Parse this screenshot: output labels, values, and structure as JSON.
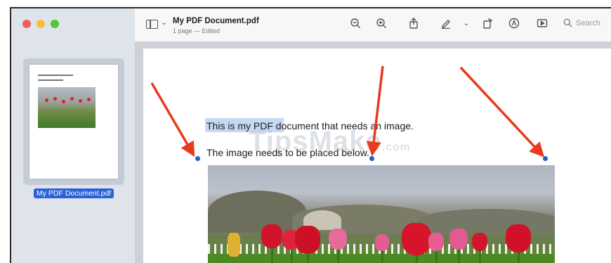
{
  "window": {
    "title": "My PDF Document.pdf",
    "subtitle": "1 page — Edited"
  },
  "sidebar": {
    "thumbnail_label": "My PDF Document.pdf"
  },
  "toolbar": {
    "search_placeholder": "Search",
    "icons": [
      "sidebar-toggle-icon",
      "zoom-out-icon",
      "zoom-in-icon",
      "share-icon",
      "markup-pen-icon",
      "rotate-icon",
      "highlight-icon",
      "slideshow-icon",
      "search-icon"
    ]
  },
  "document": {
    "line1": "This is my PDF document that needs an image.",
    "line2": "The image needs to be placed below."
  },
  "watermark": {
    "text": "TipsMake",
    "suffix": ".com"
  },
  "colors": {
    "selection": "#2b61d6",
    "annotation_arrow": "#e83a1e",
    "handle": "#2060c8"
  }
}
